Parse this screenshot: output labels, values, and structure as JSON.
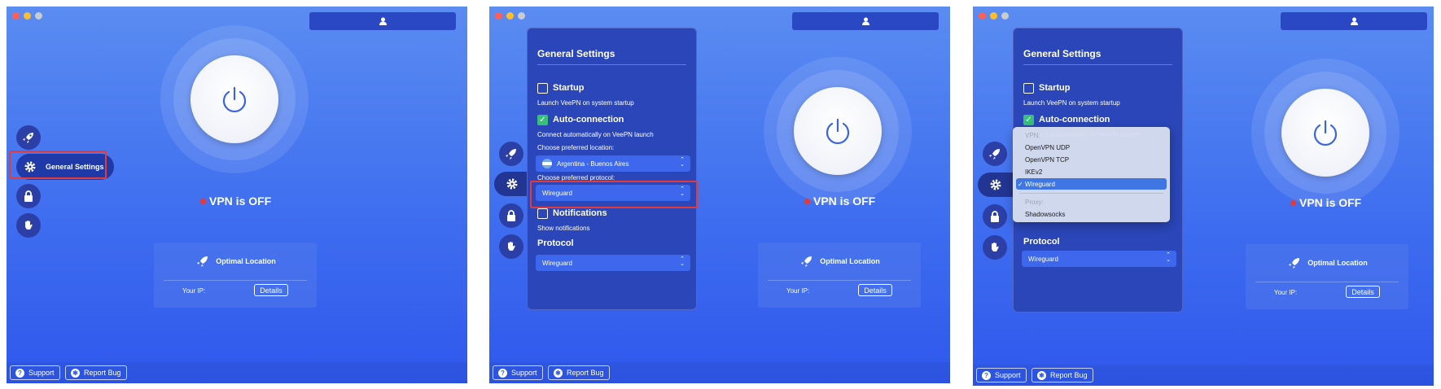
{
  "colors": {
    "accent": "#3f6ef0",
    "status_off": "#e53935",
    "checkbox_on": "#36c07a",
    "highlight": "#e23b3b"
  },
  "status": {
    "prefix_icon": "red-dot-icon",
    "text": "VPN is OFF"
  },
  "location_card": {
    "title": "Optimal Location",
    "ip_label": "Your IP:",
    "details_button": "Details"
  },
  "bottom": {
    "support": "Support",
    "report_bug": "Report Bug"
  },
  "sidebar": {
    "general_settings_label": "General Settings"
  },
  "settings": {
    "title": "General Settings",
    "startup_label": "Startup",
    "startup_desc": "Launch VeePN on system startup",
    "auto_label": "Auto-connection",
    "auto_desc": "Connect automatically on VeePN launch",
    "location_label": "Choose preferred location:",
    "location_value": "Argentina - Buenos Aires",
    "protocol_label": "Choose preferred protocol:",
    "protocol_value": "Wireguard",
    "notifications_label": "Notifications",
    "notifications_desc": "Show notifications",
    "protocol_section": "Protocol",
    "protocol_section_value": "Wireguard"
  },
  "dropdown": {
    "vpn_header": "VPN:",
    "items": [
      "OpenVPN UDP",
      "OpenVPN TCP",
      "IKEv2",
      "Wireguard"
    ],
    "selected": "Wireguard",
    "proxy_header": "Proxy:",
    "proxy_items": [
      "Shadowsocks"
    ]
  }
}
